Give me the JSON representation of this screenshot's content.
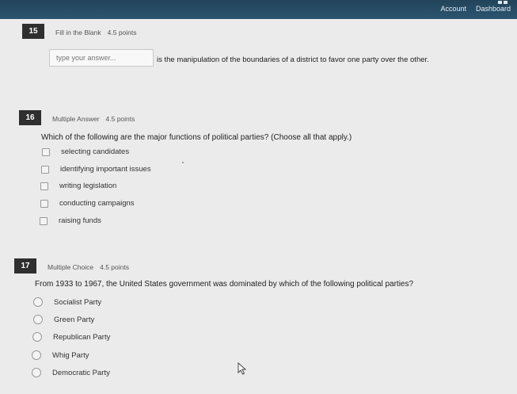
{
  "topbar": {
    "account_label": "Account",
    "dashboard_label": "Dashboard"
  },
  "q15": {
    "number": "15",
    "type": "Fill in the Blank",
    "points": "4.5 points",
    "placeholder": "type your answer...",
    "text": "is the manipulation of the boundaries of a district to favor one party over the other."
  },
  "q16": {
    "number": "16",
    "type": "Multiple Answer",
    "points": "4.5 points",
    "prompt": "Which of the following are the major functions of political parties? (Choose all that apply.)",
    "options": [
      "selecting candidates",
      "identifying important issues",
      "writing legislation",
      "conducting campaigns",
      "raising funds"
    ]
  },
  "q17": {
    "number": "17",
    "type": "Multiple Choice",
    "points": "4.5 points",
    "prompt": "From 1933 to 1967, the United States government was dominated by which of the following political parties?",
    "options": [
      "Socialist Party",
      "Green Party",
      "Republican Party",
      "Whig Party",
      "Democratic Party"
    ]
  }
}
